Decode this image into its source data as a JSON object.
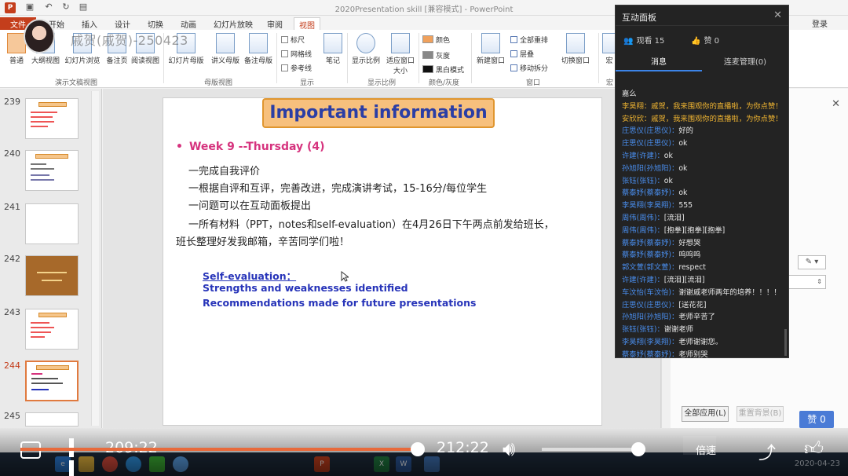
{
  "window": {
    "title": "2020Presentation skill [兼容模式] - PowerPoint",
    "login_label": "登录"
  },
  "ribbon": {
    "tabs": [
      "文件",
      "开始",
      "插入",
      "设计",
      "切换",
      "动画",
      "幻灯片放映",
      "审阅",
      "视图"
    ],
    "active_tab": "视图",
    "buttons": [
      {
        "label": "普通"
      },
      {
        "label": "大纲视图"
      },
      {
        "label": "幻灯片浏览"
      },
      {
        "label": "备注页"
      },
      {
        "label": "阅读视图"
      },
      {
        "label": "幻灯片母版"
      },
      {
        "label": "讲义母版"
      },
      {
        "label": "备注母版"
      },
      {
        "label": "笔记"
      },
      {
        "label": "显示比例"
      },
      {
        "label": "适应窗口大小"
      },
      {
        "label": "新建窗口"
      },
      {
        "label": "切换窗口"
      },
      {
        "label": "宏"
      }
    ],
    "show_checks": [
      "标尺",
      "网格线",
      "参考线"
    ],
    "color_options": [
      "颜色",
      "灰度",
      "黑白模式"
    ],
    "window_items": [
      "全部重排",
      "层叠",
      "移动拆分"
    ],
    "groups": [
      "演示文稿视图",
      "母版视图",
      "显示",
      "显示比例",
      "颜色/灰度",
      "窗口",
      "宏"
    ]
  },
  "stream": {
    "streamer_label": "戚贺(戚贺)-250423"
  },
  "thumbnails": [
    {
      "num": "239",
      "style": "agenda"
    },
    {
      "num": "240",
      "style": "list"
    },
    {
      "num": "241",
      "style": "blank"
    },
    {
      "num": "242",
      "style": "brown"
    },
    {
      "num": "243",
      "style": "agenda"
    },
    {
      "num": "244",
      "style": "active"
    },
    {
      "num": "245",
      "style": "partial"
    }
  ],
  "slide": {
    "title": "Important information",
    "week_heading": "Week 9 --Thursday (4)",
    "bullet": "•",
    "lines": [
      "一完成自我评价",
      "一根据自评和互评，完善改进，完成演讲考试，15-16分/每位学生",
      "一问题可以在互动面板提出",
      "一所有材料（PPT，notes和self-evaluation）在4月26日下午两点前发给班长，",
      "班长整理好发我邮箱，辛苦同学们啦！"
    ],
    "blue_lines": [
      "Self-evaluation：",
      "Strengths and weaknesses identified",
      "Recommendations made for future presentations"
    ]
  },
  "taskpane": {
    "apply_all": "全部应用(L)",
    "reset_bg": "重置背景(B)"
  },
  "panel": {
    "title": "互动面板",
    "viewers_label": "观看 15",
    "likes_label": "赞 0",
    "tabs": [
      "消息",
      "连麦管理(0)"
    ],
    "active_tab": "消息",
    "messages": [
      {
        "name": "",
        "text": "嘉么",
        "hl": false
      },
      {
        "name": "李昊翔：",
        "text": "戚贺，我来围观你的直播啦，为你点赞！",
        "hl": true
      },
      {
        "name": "安欣欣：",
        "text": "戚贺，我来围观你的直播啦，为你点赞！",
        "hl": true
      },
      {
        "name": "庄思仪(庄思仪)：",
        "text": "好的",
        "hl": false
      },
      {
        "name": "庄思仪(庄思仪)：",
        "text": "ok",
        "hl": false
      },
      {
        "name": "许建(许建)：",
        "text": "ok",
        "hl": false
      },
      {
        "name": "孙旭阳(孙旭阳)：",
        "text": "ok",
        "hl": false
      },
      {
        "name": "张钰(张钰)：",
        "text": "ok",
        "hl": false
      },
      {
        "name": "蔡泰妤(蔡泰妤)：",
        "text": "ok",
        "hl": false
      },
      {
        "name": "李昊翔(李昊翔)：",
        "text": "555",
        "hl": false
      },
      {
        "name": "周伟(周伟)：",
        "text": "[流泪]",
        "hl": false
      },
      {
        "name": "周伟(周伟)：",
        "text": "[抱拳][抱拳][抱拳]",
        "hl": false
      },
      {
        "name": "蔡泰妤(蔡泰妤)：",
        "text": "好想哭",
        "hl": false
      },
      {
        "name": "蔡泰妤(蔡泰妤)：",
        "text": "呜呜呜",
        "hl": false
      },
      {
        "name": "郭文萱(郭文萱)：",
        "text": "respect",
        "hl": false
      },
      {
        "name": "许建(许建)：",
        "text": "[流泪][流泪]",
        "hl": false
      },
      {
        "name": "车汶怡(车汶怡)：",
        "text": "谢谢戚老师两年的培养！！！！",
        "hl": false
      },
      {
        "name": "庄思仪(庄思仪)：",
        "text": "[送花花]",
        "hl": false
      },
      {
        "name": "孙旭阳(孙旭阳)：",
        "text": "老师辛苦了",
        "hl": false
      },
      {
        "name": "张钰(张钰)：",
        "text": "谢谢老师",
        "hl": false
      },
      {
        "name": "李昊翔(李昊翔)：",
        "text": "老师谢谢您。",
        "hl": false
      },
      {
        "name": "蔡泰妤(蔡泰妤)：",
        "text": "老师别哭",
        "hl": false
      }
    ]
  },
  "player": {
    "current_time": "209:22",
    "total_time": "212:22",
    "progress": 0.985,
    "volume": 0.93,
    "speed_label": "倍速",
    "like_badge": "赞 0"
  },
  "taskbar": {
    "date": "2020-04-23",
    "apps": [
      "IE",
      "Folder",
      "Chrome",
      "QQ",
      "WeChat",
      "Browser",
      "PPT",
      "Excel",
      "Word",
      "App"
    ]
  },
  "colors": {
    "ppt_red": "#c43e1c",
    "panel_bg": "#232323",
    "msg_name": "#4a8ff0",
    "msg_highlight": "#f0b532",
    "slide_title_fill": "#f7c07d",
    "slide_title_text": "#2b3ea5",
    "week_pink": "#d6337e",
    "blue_text": "#2734b9",
    "progress": "#e86a3b"
  }
}
